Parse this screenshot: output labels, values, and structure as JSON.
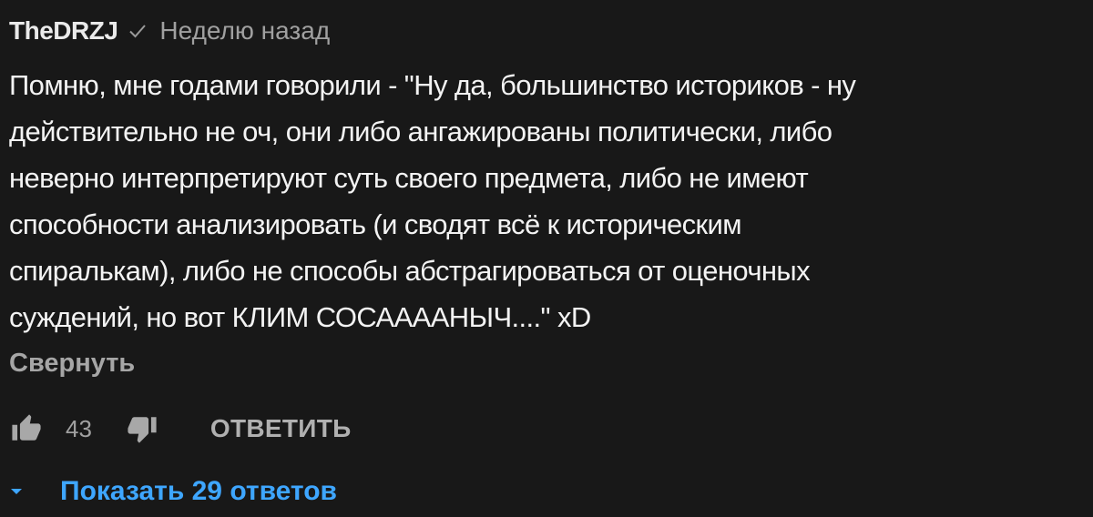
{
  "comment": {
    "author": "TheDRZJ",
    "timestamp": "Неделю назад",
    "text": "Помню, мне годами говорили - \"Ну да, большинство историков - ну\nдействительно не оч, они либо ангажированы политически, либо\nневерно интерпретируют суть своего предмета, либо не имеют\nспособности анализировать (и сводят всё к историческим\nспиралькам), либо не способы абстрагироваться от оценочных\nсуждений, но вот КЛИМ СОСААААНЫЧ....\" xD",
    "collapse_label": "Свернуть",
    "like_count": "43",
    "reply_label": "ОТВЕТИТЬ",
    "show_replies_label": "Показать 29 ответов"
  },
  "icons": {
    "verified": "check-icon",
    "like": "thumbs-up-icon",
    "dislike": "thumbs-down-icon",
    "expand": "caret-down-icon"
  },
  "colors": {
    "background": "#181818",
    "text": "#f1f1f1",
    "secondary_text": "#a0a0a0",
    "link_blue": "#3ea6ff"
  }
}
